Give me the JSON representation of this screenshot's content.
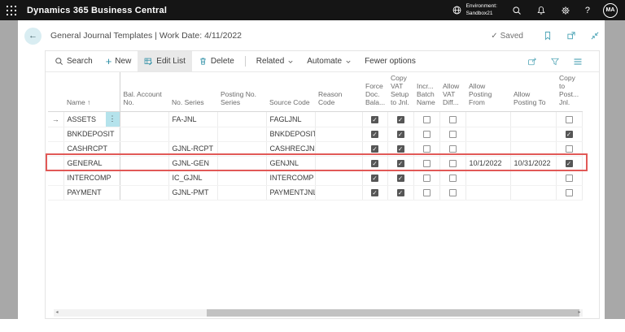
{
  "topbar": {
    "app_title": "Dynamics 365 Business Central",
    "environment": {
      "label": "Environment:",
      "name": "Sandbox21"
    },
    "avatar": "MA"
  },
  "page": {
    "title": "General Journal Templates | Work Date: 4/11/2022",
    "saved": "Saved"
  },
  "toolbar": {
    "search": "Search",
    "new": "New",
    "edit_list": "Edit List",
    "delete": "Delete",
    "related": "Related",
    "automate": "Automate",
    "fewer_options": "Fewer options"
  },
  "table": {
    "columns": [
      {
        "key": "name",
        "label": "Name",
        "type": "text",
        "sort": "asc"
      },
      {
        "key": "bal_account_no",
        "label": "Bal. Account No.",
        "type": "text"
      },
      {
        "key": "no_series",
        "label": "No. Series",
        "type": "text"
      },
      {
        "key": "posting_no_series",
        "label": "Posting No. Series",
        "type": "text"
      },
      {
        "key": "source_code",
        "label": "Source Code",
        "type": "text"
      },
      {
        "key": "reason_code",
        "label": "Reason Code",
        "type": "text"
      },
      {
        "key": "force_doc_balance",
        "label": "Force Doc. Bala...",
        "type": "check"
      },
      {
        "key": "copy_vat_setup",
        "label": "Copy VAT Setup to Jnl.",
        "type": "check"
      },
      {
        "key": "incr_batch_name",
        "label": "Incr... Batch Name",
        "type": "check"
      },
      {
        "key": "allow_vat_diff",
        "label": "Allow VAT Diff...",
        "type": "check"
      },
      {
        "key": "allow_posting_from",
        "label": "Allow Posting From",
        "type": "text"
      },
      {
        "key": "allow_posting_to",
        "label": "Allow Posting To",
        "type": "text"
      },
      {
        "key": "copy_to_post_jnl",
        "label": "Copy to Post... Jnl.",
        "type": "check"
      }
    ],
    "rows": [
      {
        "name": "ASSETS",
        "bal_account_no": "",
        "no_series": "FA-JNL",
        "posting_no_series": "",
        "source_code": "FAGLJNL",
        "reason_code": "",
        "force_doc_balance": true,
        "copy_vat_setup": true,
        "incr_batch_name": false,
        "allow_vat_diff": false,
        "allow_posting_from": "",
        "allow_posting_to": "",
        "copy_to_post_jnl": false,
        "focused": true
      },
      {
        "name": "BNKDEPOSIT",
        "bal_account_no": "",
        "no_series": "",
        "posting_no_series": "",
        "source_code": "BNKDEPOSIT",
        "reason_code": "",
        "force_doc_balance": true,
        "copy_vat_setup": true,
        "incr_batch_name": false,
        "allow_vat_diff": false,
        "allow_posting_from": "",
        "allow_posting_to": "",
        "copy_to_post_jnl": true
      },
      {
        "name": "CASHRCPT",
        "bal_account_no": "",
        "no_series": "GJNL-RCPT",
        "posting_no_series": "",
        "source_code": "CASHRECJNL",
        "reason_code": "",
        "force_doc_balance": true,
        "copy_vat_setup": true,
        "incr_batch_name": false,
        "allow_vat_diff": false,
        "allow_posting_from": "",
        "allow_posting_to": "",
        "copy_to_post_jnl": false
      },
      {
        "name": "GENERAL",
        "bal_account_no": "",
        "no_series": "GJNL-GEN",
        "posting_no_series": "",
        "source_code": "GENJNL",
        "reason_code": "",
        "force_doc_balance": true,
        "copy_vat_setup": true,
        "incr_batch_name": false,
        "allow_vat_diff": false,
        "allow_posting_from": "10/1/2022",
        "allow_posting_to": "10/31/2022",
        "copy_to_post_jnl": true,
        "highlighted": true
      },
      {
        "name": "INTERCOMP",
        "bal_account_no": "",
        "no_series": "IC_GJNL",
        "posting_no_series": "",
        "source_code": "INTERCOMP",
        "reason_code": "",
        "force_doc_balance": true,
        "copy_vat_setup": true,
        "incr_batch_name": false,
        "allow_vat_diff": false,
        "allow_posting_from": "",
        "allow_posting_to": "",
        "copy_to_post_jnl": false
      },
      {
        "name": "PAYMENT",
        "bal_account_no": "",
        "no_series": "GJNL-PMT",
        "posting_no_series": "",
        "source_code": "PAYMENTJNL",
        "reason_code": "",
        "force_doc_balance": true,
        "copy_vat_setup": true,
        "incr_batch_name": false,
        "allow_vat_diff": false,
        "allow_posting_from": "",
        "allow_posting_to": "",
        "copy_to_post_jnl": false
      }
    ]
  },
  "icons": {
    "back_arrow": "←",
    "saved_check": "✓",
    "checkmark": "✓",
    "plus": "+",
    "help": "?",
    "row_indicator": "→",
    "row_menu": "⋮",
    "sort_asc": "↑",
    "scroll_left": "◂",
    "scroll_right": "▸"
  },
  "colors": {
    "topbar_bg": "#151515",
    "accent_teal": "#2e8fa5",
    "highlight_red": "#e15957",
    "focus_menu_bg": "#b5e3ec",
    "checkbox_checked": "#565656"
  }
}
